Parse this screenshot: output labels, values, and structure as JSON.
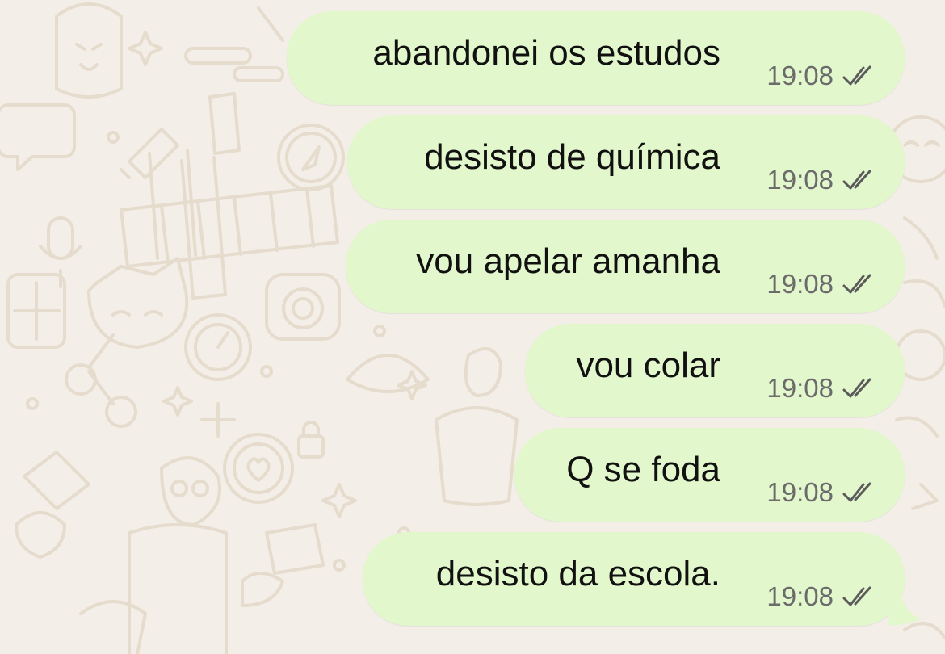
{
  "conversation": {
    "messages": [
      {
        "text": "abandonei os estudos",
        "time": "19:08",
        "status": "read-double-check"
      },
      {
        "text": "desisto de química",
        "time": "19:08",
        "status": "read-double-check"
      },
      {
        "text": "vou apelar amanha",
        "time": "19:08",
        "status": "read-double-check"
      },
      {
        "text": "vou colar",
        "time": "19:08",
        "status": "read-double-check"
      },
      {
        "text": "Q se foda",
        "time": "19:08",
        "status": "read-double-check"
      },
      {
        "text": "desisto da escola.",
        "time": "19:08",
        "status": "read-double-check"
      }
    ]
  },
  "colors": {
    "background": "#f3eee7",
    "bubble_outgoing": "#e2f7cb",
    "text": "#111111",
    "meta_text": "#6b6b6b",
    "wallpaper_line": "#e6dccd"
  },
  "icons": {
    "status": "double-check-icon",
    "wallpaper": "doodle-pattern"
  }
}
